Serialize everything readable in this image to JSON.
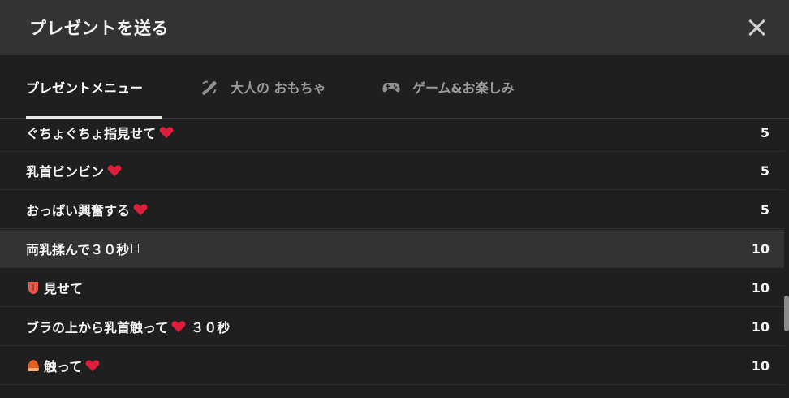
{
  "header": {
    "title": "プレゼントを送る"
  },
  "tabs": [
    {
      "label": "プレゼントメニュー",
      "icon": ""
    },
    {
      "label": "大人の おもちゃ",
      "icon": "toy-icon"
    },
    {
      "label": "ゲーム&お楽しみ",
      "icon": "gamepad-icon"
    }
  ],
  "items": [
    {
      "label": "ぐちょぐちょ指見せて",
      "points": "5"
    },
    {
      "label": "乳首ビンビン",
      "points": "5"
    },
    {
      "label": "おっぱい興奮する",
      "points": "5"
    },
    {
      "label": "両乳揉んで３０秒",
      "points": "10"
    },
    {
      "label": "見せて",
      "points": "10"
    },
    {
      "label": "ブラの上から乳首触って",
      "label_suffix": "３０秒",
      "points": "10"
    },
    {
      "label": "触って",
      "points": "10"
    }
  ],
  "colors": {
    "heart": "#e01e3c",
    "header_bg": "#333333",
    "body_bg": "#1f1f1f"
  }
}
